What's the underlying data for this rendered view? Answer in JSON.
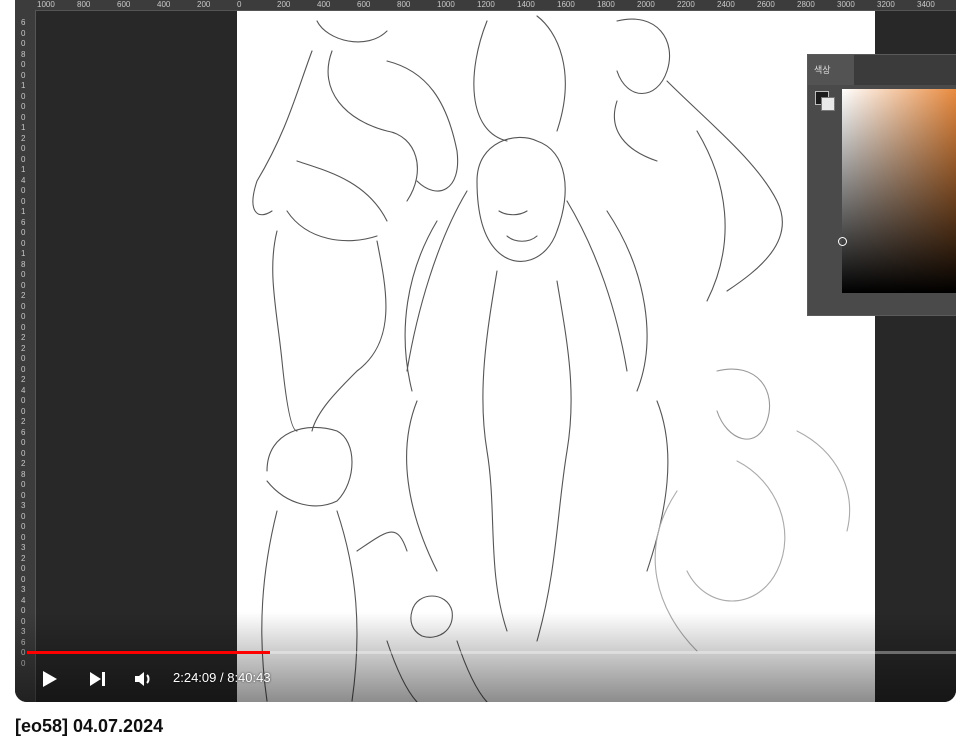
{
  "ruler": {
    "top_labels": [
      "1000",
      "800",
      "600",
      "400",
      "200",
      "0",
      "200",
      "400",
      "600",
      "800",
      "1000",
      "1200",
      "1400",
      "1600",
      "1800",
      "2000",
      "2200",
      "2400",
      "2600",
      "2800",
      "3000",
      "3200",
      "3400"
    ],
    "left_digits": [
      "6",
      "0",
      "0",
      "8",
      "0",
      "0",
      "1",
      "0",
      "0",
      "0",
      "1",
      "2",
      "0",
      "0",
      "1",
      "4",
      "0",
      "0",
      "1",
      "6",
      "0",
      "0",
      "1",
      "8",
      "0",
      "0",
      "2",
      "0",
      "0",
      "0",
      "2",
      "2",
      "0",
      "0",
      "2",
      "4",
      "0",
      "0",
      "2",
      "6",
      "0",
      "0",
      "2",
      "8",
      "0",
      "0",
      "3",
      "0",
      "0",
      "0",
      "3",
      "2",
      "0",
      "0",
      "3",
      "4",
      "0",
      "0",
      "3",
      "6",
      "0",
      "0"
    ]
  },
  "color_panel": {
    "tab_label": "색상",
    "gradient_color": "#e8893d"
  },
  "player": {
    "progress": 0.262,
    "time_display": "2:24:09 / 8:40:43",
    "play_icon": "play-icon",
    "next_icon": "next-icon",
    "volume_icon": "volume-icon",
    "accent_color": "#ff0000"
  },
  "video_title": "[eo58] 04.07.2024"
}
